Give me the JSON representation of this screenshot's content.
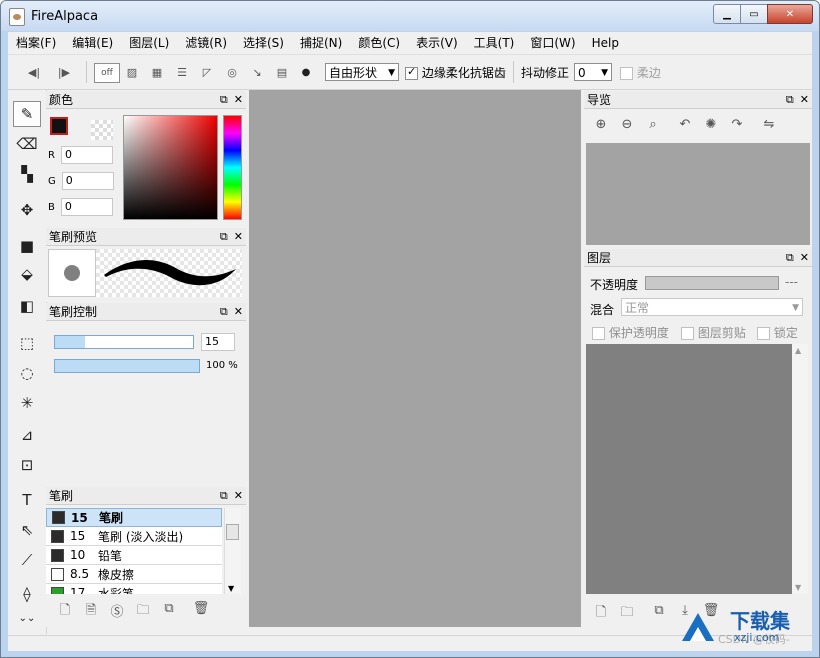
{
  "window": {
    "title": "FireAlpaca"
  },
  "menu": [
    "档案(F)",
    "编辑(E)",
    "图层(L)",
    "滤镜(R)",
    "选择(S)",
    "捕捉(N)",
    "颜色(C)",
    "表示(V)",
    "工具(T)",
    "窗口(W)",
    "Help"
  ],
  "toolbar": {
    "snap_off": "off",
    "shape_select": "自由形状",
    "antialias_label": "边缘柔化抗锯齿",
    "correction_label": "抖动修正",
    "correction_value": "0",
    "soft_edge_label": "柔边"
  },
  "color_panel": {
    "title": "颜色",
    "r_label": "R",
    "g_label": "G",
    "b_label": "B",
    "r": "0",
    "g": "0",
    "b": "0"
  },
  "brush_preview": {
    "title": "笔刷预览"
  },
  "brush_control": {
    "title": "笔刷控制",
    "size": "15",
    "opacity": "100",
    "opacity_unit": "%",
    "size_fraction": 0.22,
    "opacity_fraction": 1.0
  },
  "brush_panel": {
    "title": "笔刷",
    "items": [
      {
        "size": "15",
        "name": "笔刷",
        "color": "#2b2b2b"
      },
      {
        "size": "15",
        "name": "笔刷 (淡入淡出)",
        "color": "#2b2b2b"
      },
      {
        "size": "10",
        "name": "铅笔",
        "color": "#2b2b2b"
      },
      {
        "size": "8.5",
        "name": "橡皮擦",
        "color": "#ffffff"
      },
      {
        "size": "17",
        "name": "水彩笔",
        "color": "#2aa02a"
      }
    ]
  },
  "navigator": {
    "title": "导览"
  },
  "layers": {
    "title": "图层",
    "opacity_label": "不透明度",
    "opacity_value": "---",
    "blend_label": "混合",
    "blend_value": "正常",
    "protect_label": "保护透明度",
    "clip_label": "图层剪贴",
    "lock_label": "锁定"
  },
  "watermark": {
    "main": "下载集",
    "sub": "xzji.com",
    "csdn": "CSDN @牧码-"
  }
}
